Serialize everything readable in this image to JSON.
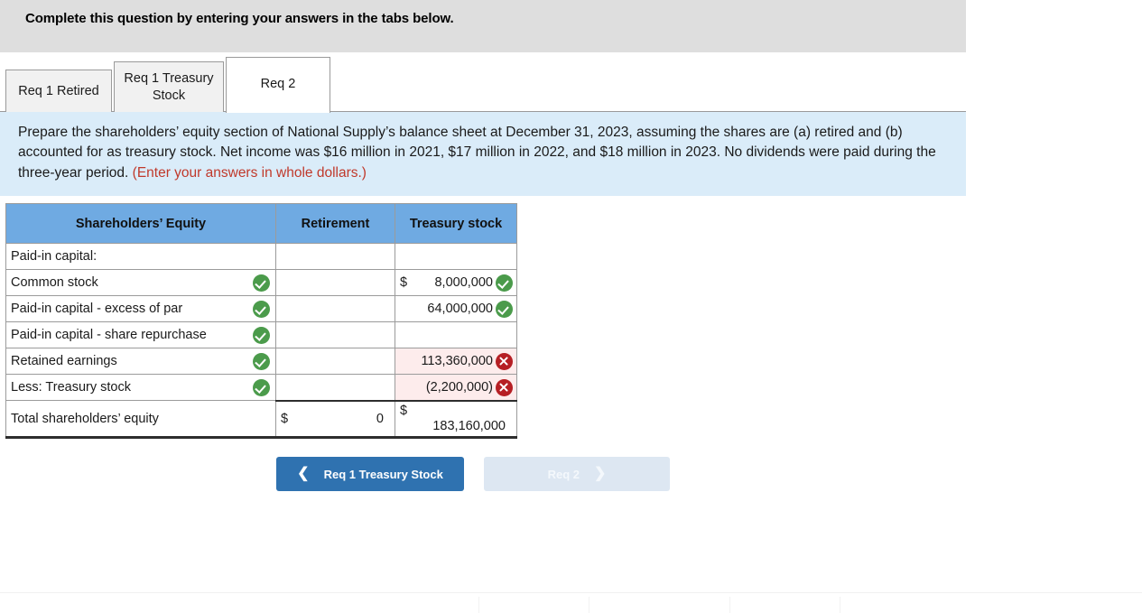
{
  "banner": {
    "text": "Complete this question by entering your answers in the tabs below."
  },
  "tabs": [
    {
      "label": "Req 1 Retired",
      "active": false
    },
    {
      "label": "Req 1 Treasury Stock",
      "active": false
    },
    {
      "label": "Req 2",
      "active": true
    }
  ],
  "question": {
    "body": "Prepare the shareholders’ equity section of National Supply’s balance sheet at December 31, 2023, assuming the shares are (a) retired and (b) accounted for as treasury stock. Net income was $16 million in 2021, $17 million in 2022, and $18 million in 2023. No dividends were paid during the three-year period.",
    "note": "(Enter your answers in whole dollars.)"
  },
  "table": {
    "headers": [
      "Shareholders’ Equity",
      "Retirement",
      "Treasury stock"
    ],
    "rows": [
      {
        "label": "Paid-in capital:",
        "label_status": "",
        "retirement": "",
        "treasury_dollar": "",
        "treasury": "",
        "treasury_status": ""
      },
      {
        "label": "Common stock",
        "label_status": "ok",
        "retirement": "",
        "treasury_dollar": "$",
        "treasury": "8,000,000",
        "treasury_status": "ok"
      },
      {
        "label": "Paid-in capital - excess of par",
        "label_status": "ok",
        "retirement": "",
        "treasury_dollar": "",
        "treasury": "64,000,000",
        "treasury_status": "ok"
      },
      {
        "label": "Paid-in capital - share repurchase",
        "label_status": "ok",
        "retirement": "",
        "treasury_dollar": "",
        "treasury": "",
        "treasury_status": ""
      },
      {
        "label": "Retained earnings",
        "label_status": "ok",
        "retirement": "",
        "treasury_dollar": "",
        "treasury": "113,360,000",
        "treasury_status": "err"
      },
      {
        "label": "Less: Treasury stock",
        "label_status": "ok",
        "retirement": "",
        "treasury_dollar": "",
        "treasury": "(2,200,000)",
        "treasury_status": "err"
      }
    ],
    "total": {
      "label": "Total shareholders’ equity",
      "retirement_dollar": "$",
      "retirement_value": "0",
      "treasury_dollar": "$",
      "treasury_value": "183,160,000"
    }
  },
  "nav": {
    "prev_label": "Req 1 Treasury Stock",
    "prev_icon": "chevron-left-icon",
    "next_label": "Req 2",
    "next_icon": "chevron-right-icon"
  },
  "colors": {
    "banner_bg": "#dedede",
    "question_bg": "#daecf9",
    "table_header_bg": "#6faae2",
    "error_row_bg": "#fdecec",
    "note_color": "#c0392b",
    "prev_button_bg": "#2f72b0",
    "next_button_bg": "#dde7f2",
    "ok_icon": "#4b9b4b",
    "err_icon": "#b61f24"
  }
}
